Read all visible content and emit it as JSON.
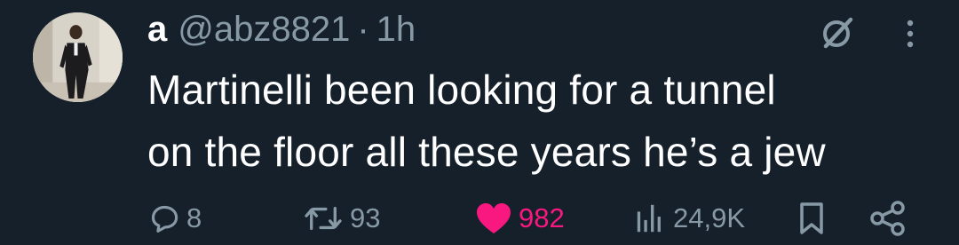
{
  "author": {
    "display_name": "a",
    "handle": "@abz8821",
    "separator": "·",
    "timestamp": "1h"
  },
  "tweet": {
    "text": "Martinelli been looking for a tunnel\non the floor all these years he’s a jew"
  },
  "actions": {
    "replies": "8",
    "retweets": "93",
    "likes": "982",
    "views": "24,9K"
  },
  "icons": {
    "grok": "grok-slash-icon",
    "more": "more-vertical-icon",
    "reply": "reply-bubble-icon",
    "retweet": "retweet-icon",
    "like": "heart-filled-icon",
    "views": "views-bar-chart-icon",
    "bookmark": "bookmark-icon",
    "share": "share-icon"
  },
  "colors": {
    "background": "#15202b",
    "text_primary": "#ffffff",
    "text_secondary": "#8899a6",
    "like_pink": "#f91880"
  }
}
